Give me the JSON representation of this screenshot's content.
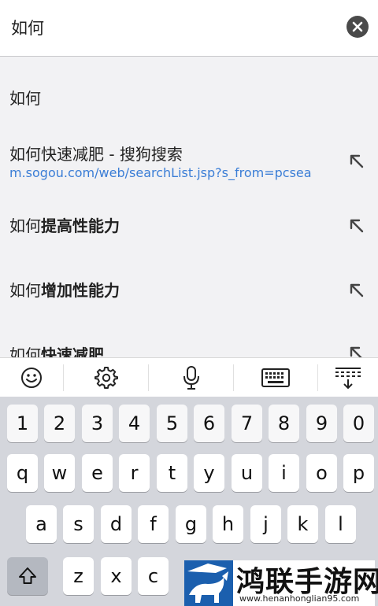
{
  "search": {
    "value": "如何",
    "clear_icon": "close-icon"
  },
  "suggestions": [
    {
      "prefix": "如何",
      "bold": "",
      "url": ""
    },
    {
      "prefix": "如何快速减肥 - 搜狗搜索",
      "bold": "",
      "url": "m.sogou.com/web/searchList.jsp?s_from=pcsea"
    },
    {
      "prefix": "如何",
      "bold": "提高性能力",
      "url": ""
    },
    {
      "prefix": "如何",
      "bold": "增加性能力",
      "url": ""
    },
    {
      "prefix": "如何",
      "bold": "快速减肥",
      "url": ""
    }
  ],
  "toolbar": [
    "emoji-icon",
    "gear-icon",
    "microphone-icon",
    "keyboard-icon",
    "collapse-keyboard-icon"
  ],
  "keyboard": {
    "row_numbers": [
      "1",
      "2",
      "3",
      "4",
      "5",
      "6",
      "7",
      "8",
      "9",
      "0"
    ],
    "row_top": [
      "q",
      "w",
      "e",
      "r",
      "t",
      "y",
      "u",
      "i",
      "o",
      "p"
    ],
    "row_mid": [
      "a",
      "s",
      "d",
      "f",
      "g",
      "h",
      "j",
      "k",
      "l"
    ],
    "row_bottom": [
      "z",
      "x",
      "c"
    ],
    "shift_icon": "shift-icon"
  },
  "watermark": {
    "title": "鸿联手游网",
    "url": "www.henanhonglian95.com"
  }
}
